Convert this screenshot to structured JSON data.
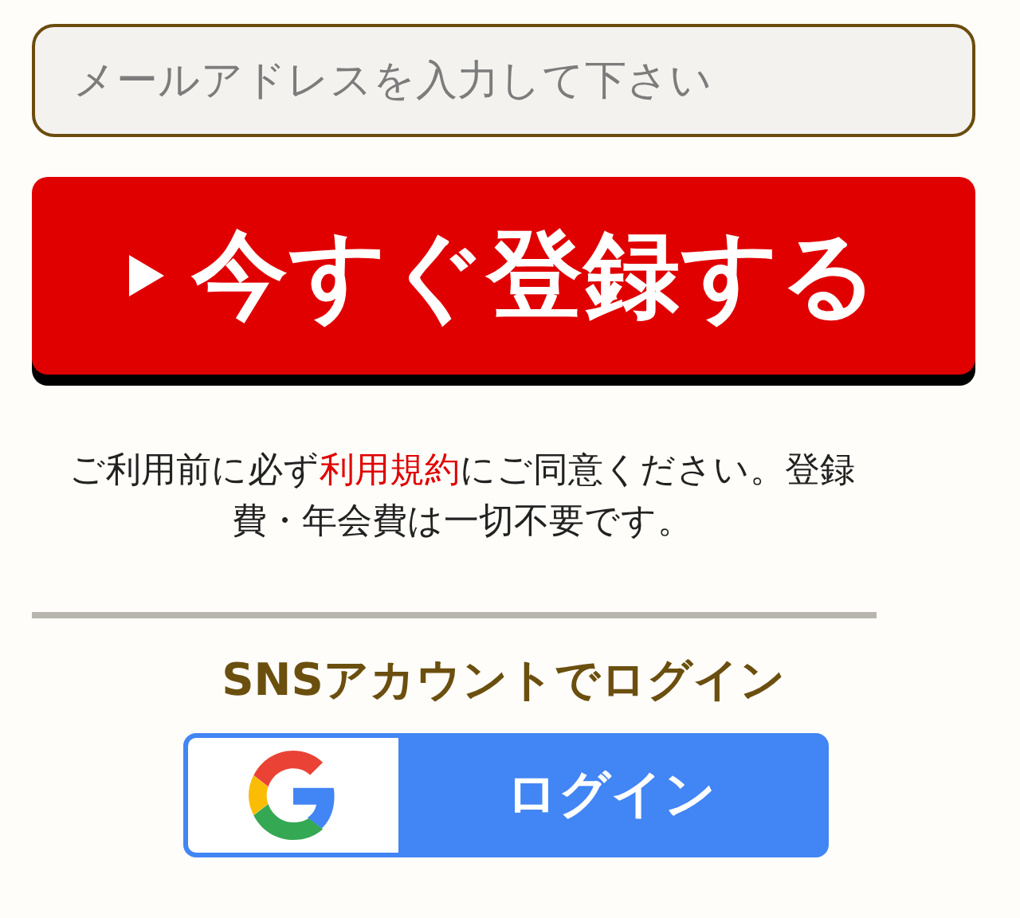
{
  "email_field": {
    "placeholder": "メールアドレスを入力して下さい"
  },
  "register_button": {
    "label": "今すぐ登録する"
  },
  "notice": {
    "before": "ご利用前に必ず",
    "link": "利用規約",
    "after": "にご同意ください。登録費・年会費は一切不要です。"
  },
  "sns_heading": "SNSアカウントでログイン",
  "google_button": {
    "label": "ログイン"
  }
}
